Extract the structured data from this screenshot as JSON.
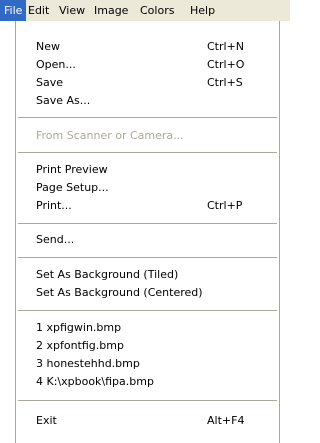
{
  "menubar": {
    "items": [
      {
        "label": "File",
        "active": true
      },
      {
        "label": "Edit",
        "active": false
      },
      {
        "label": "View",
        "active": false
      },
      {
        "label": "Image",
        "active": false
      },
      {
        "label": "Colors",
        "active": false
      },
      {
        "label": "Help",
        "active": false
      }
    ]
  },
  "file_menu": {
    "items": [
      {
        "label": "New",
        "shortcut": "Ctrl+N",
        "enabled": true
      },
      {
        "label": "Open...",
        "shortcut": "Ctrl+O",
        "enabled": true
      },
      {
        "label": "Save",
        "shortcut": "Ctrl+S",
        "enabled": true
      },
      {
        "label": "Save As...",
        "shortcut": "",
        "enabled": true
      },
      {
        "label": "From Scanner or Camera...",
        "shortcut": "",
        "enabled": false
      },
      {
        "label": "Print Preview",
        "shortcut": "",
        "enabled": true
      },
      {
        "label": "Page Setup...",
        "shortcut": "",
        "enabled": true
      },
      {
        "label": "Print...",
        "shortcut": "Ctrl+P",
        "enabled": true
      },
      {
        "label": "Send...",
        "shortcut": "",
        "enabled": true
      },
      {
        "label": "Set As Background (Tiled)",
        "shortcut": "",
        "enabled": true
      },
      {
        "label": "Set As Background (Centered)",
        "shortcut": "",
        "enabled": true
      },
      {
        "label": "1 xpfigwin.bmp",
        "shortcut": "",
        "enabled": true
      },
      {
        "label": "2 xpfontfig.bmp",
        "shortcut": "",
        "enabled": true
      },
      {
        "label": "3 honestehhd.bmp",
        "shortcut": "",
        "enabled": true
      },
      {
        "label": "4 K:\\xpbook\\fipa.bmp",
        "shortcut": "",
        "enabled": true
      },
      {
        "label": "Exit",
        "shortcut": "Alt+F4",
        "enabled": true
      }
    ]
  },
  "colors": {
    "menubar_bg": "#ece9d8",
    "highlight": "#316ac5",
    "disabled_text": "#aca899",
    "separator": "#aca899"
  }
}
